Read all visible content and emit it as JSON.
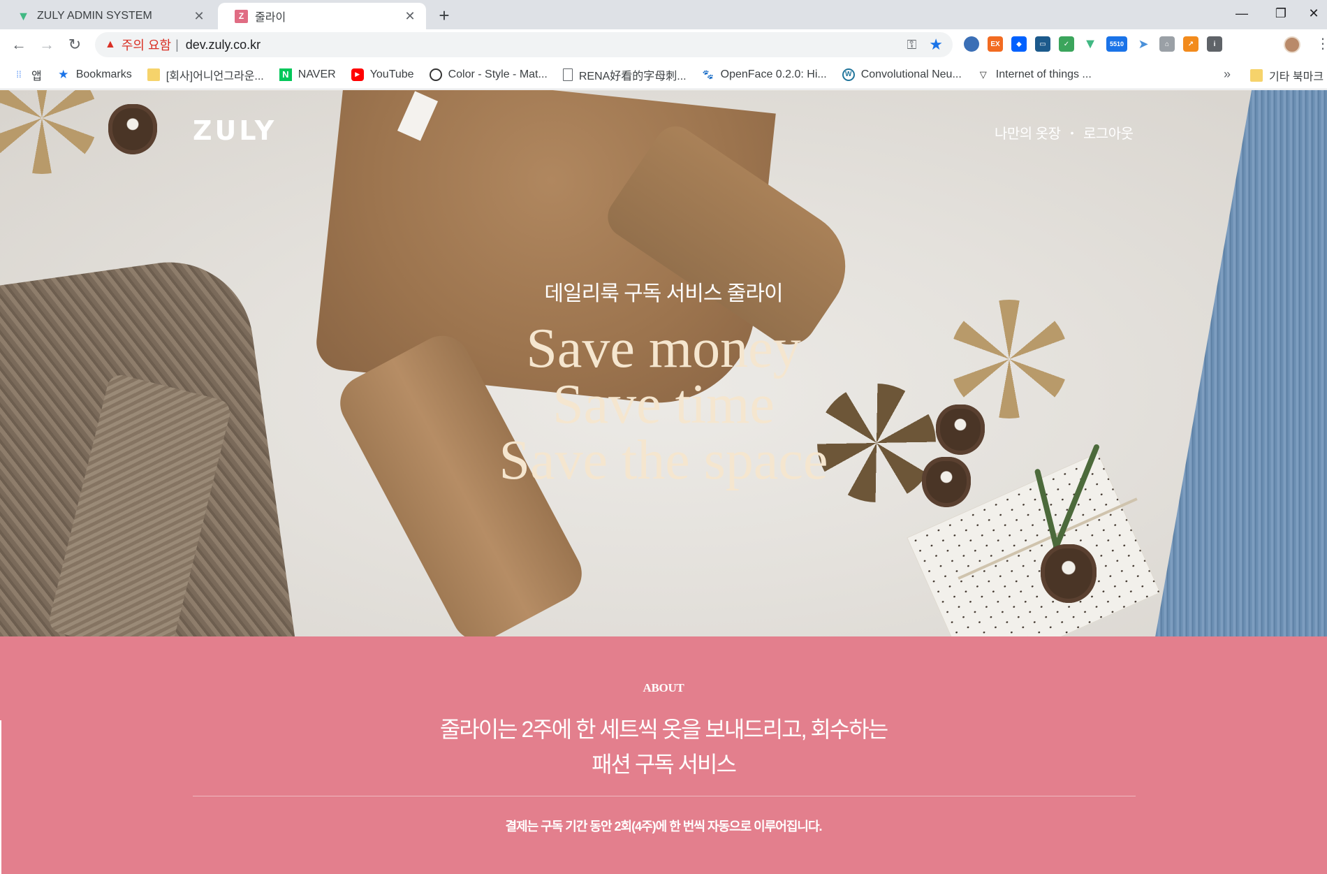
{
  "browser": {
    "tabs": [
      {
        "title": "ZULY ADMIN SYSTEM",
        "favicon": "vue-icon",
        "active": false
      },
      {
        "title": "줄라이",
        "favicon": "zuly-icon",
        "active": true
      }
    ],
    "address": {
      "warning": "주의 요함",
      "url": "dev.zuly.co.kr"
    },
    "bookmarks": [
      {
        "label": "앱",
        "icon": "apps-grid-icon"
      },
      {
        "label": "Bookmarks",
        "icon": "star-icon"
      },
      {
        "label": "[회사]어니언그라운...",
        "icon": "folder-icon"
      },
      {
        "label": "NAVER",
        "icon": "naver-icon"
      },
      {
        "label": "YouTube",
        "icon": "youtube-icon"
      },
      {
        "label": "Color - Style - Mat...",
        "icon": "material-icon"
      },
      {
        "label": "RENA好看的字母刺...",
        "icon": "page-icon"
      },
      {
        "label": "OpenFace 0.2.0: Hi...",
        "icon": "paw-icon"
      },
      {
        "label": "Convolutional Neu...",
        "icon": "wordpress-icon"
      },
      {
        "label": "Internet of things ...",
        "icon": "triangle-icon"
      }
    ],
    "other_bookmarks": "기타 북마크",
    "extension_badge": "5510"
  },
  "site": {
    "logo": "ZULY",
    "nav": {
      "closet": "나만의 옷장",
      "separator": "•",
      "logout": "로그아웃"
    },
    "hero": {
      "subtitle": "데일리룩 구독 서비스 줄라이",
      "line1": "Save money",
      "line2": "Save time",
      "line3": "Save the space"
    },
    "about": {
      "title": "ABOUT",
      "headline1": "줄라이는 2주에 한 세트씩 옷을 보내드리고, 회수하는",
      "headline2": "패션 구독 서비스",
      "note": "결제는 구독 기간 동안 2회(4주)에 한 번씩 자동으로 이루어집니다."
    }
  },
  "colors": {
    "about_bg": "#e37f8d",
    "hero_text": "#f5e6cf",
    "warning": "#d93025",
    "star": "#1a73e8"
  }
}
